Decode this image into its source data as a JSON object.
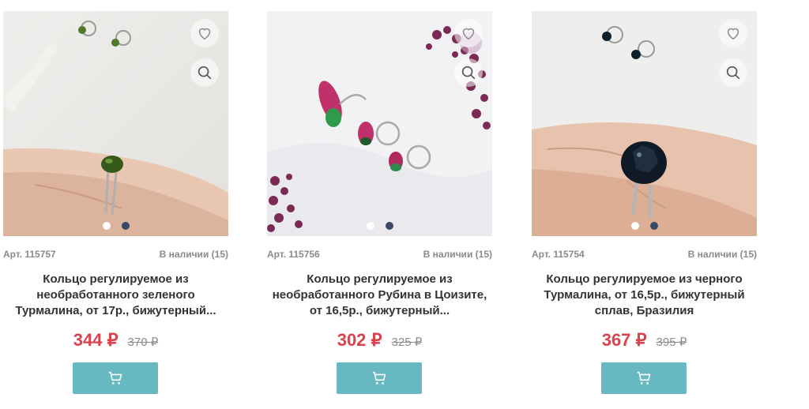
{
  "colors": {
    "price": "#d9434e",
    "old_price": "#8c8c8c",
    "cart_button": "#67b8c0",
    "dot_active": "#3a4a66"
  },
  "icons": {
    "favorite": "heart-icon",
    "zoom": "magnifier-icon",
    "cart": "cart-icon"
  },
  "products": [
    {
      "article": "Арт. 115757",
      "stock": "В наличии (15)",
      "title": "Кольцо регулируемое из необработанного зеленого Турмалина, от 17р., бижутерный...",
      "price": "344 ₽",
      "old_price": "370 ₽"
    },
    {
      "article": "Арт. 115756",
      "stock": "В наличии (15)",
      "title": "Кольцо регулируемое из необработанного Рубина в Цоизите, от 16,5р., бижутерный...",
      "price": "302 ₽",
      "old_price": "325 ₽"
    },
    {
      "article": "Арт. 115754",
      "stock": "В наличии (15)",
      "title": "Кольцо регулируемое из черного Турмалина, от 16,5р., бижутерный сплав, Бразилия",
      "price": "367 ₽",
      "old_price": "395 ₽"
    }
  ]
}
